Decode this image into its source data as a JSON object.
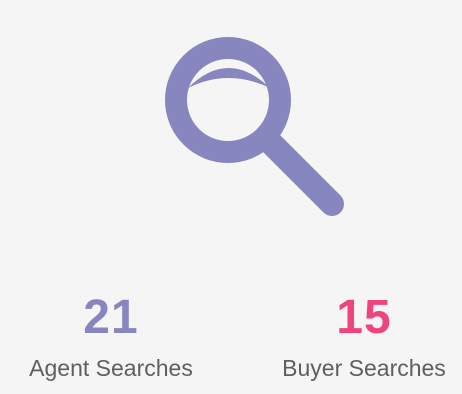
{
  "colors": {
    "icon": "#8886bf",
    "agent_accent": "#8886bf",
    "buyer_accent": "#f0447f",
    "label_text": "#5f5f5f",
    "background": "#f5f5f5"
  },
  "hero": {
    "icon": "search-icon"
  },
  "stats": {
    "agent": {
      "value": "21",
      "label": "Agent Searches"
    },
    "buyer": {
      "value": "15",
      "label": "Buyer Searches"
    }
  }
}
